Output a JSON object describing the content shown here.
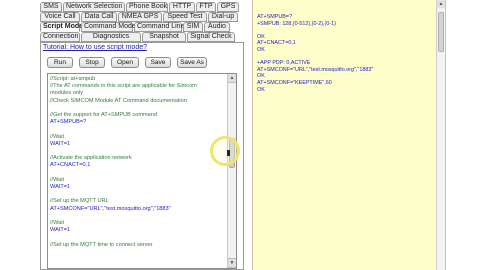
{
  "tabs": {
    "row1": [
      "SMS",
      "Network Selection",
      "Phone Book",
      "HTTP",
      "FTP",
      "GPS"
    ],
    "row2": [
      "Voice Call",
      "Data Call",
      "NMEA GPS",
      "Speed Test",
      "Dial-up"
    ],
    "row3": [
      "Script Mode",
      "Command Mode",
      "Command Line",
      "SIM",
      "Audio"
    ],
    "row4": [
      "Connection",
      "Diagnostics",
      "Snapshot",
      "Signal Check"
    ],
    "active": "Script Mode"
  },
  "tutorial_link": "Tutorial: How to use script mode?",
  "buttons": {
    "run": "Run",
    "stop": "Stop",
    "open": "Open",
    "save": "Save",
    "save_as": "Save As"
  },
  "script_lines": [
    {
      "text": "//Script: at+smpub",
      "type": "c"
    },
    {
      "text": "//The AT commands in this script are applicable for Simcom",
      "type": "c"
    },
    {
      "text": "modules only",
      "type": "c"
    },
    {
      "text": "//Check SIMCOM Module AT Command documentation",
      "type": "c"
    },
    {
      "text": "",
      "type": "k"
    },
    {
      "text": "//Get the support for AT+SMPUB command",
      "type": "c"
    },
    {
      "text": "AT+SMPUB=?",
      "type": "k"
    },
    {
      "text": "",
      "type": "k"
    },
    {
      "text": "//Wait",
      "type": "c"
    },
    {
      "text": "WAIT=1",
      "type": "k"
    },
    {
      "text": "",
      "type": "k"
    },
    {
      "text": "//Activate the application network",
      "type": "c"
    },
    {
      "text": "AT+CNACT=0,1",
      "type": "k"
    },
    {
      "text": "",
      "type": "k"
    },
    {
      "text": "//Wait",
      "type": "c"
    },
    {
      "text": "WAIT=1",
      "type": "k"
    },
    {
      "text": "",
      "type": "k"
    },
    {
      "text": "//Set up the MQTT URL",
      "type": "c"
    },
    {
      "text": "AT+SMCONF=\"URL\",\"test.mosquitto.org\",\"1883\"",
      "type": "k"
    },
    {
      "text": "",
      "type": "k"
    },
    {
      "text": "//Wait",
      "type": "c"
    },
    {
      "text": "WAIT=1",
      "type": "k"
    },
    {
      "text": "",
      "type": "k"
    },
    {
      "text": "//Set up the MQTT time to connect server",
      "type": "c"
    }
  ],
  "terminal_lines": [
    "AT+SMPUB=?",
    "+SMPUB: 128,(0-512),(0-2),(0-1)",
    "",
    "OK",
    "AT+CNACT=0,1",
    "OK",
    "",
    "+APP PDP: 0,ACTIVE",
    "AT+SMCONF=\"URL\",\"test.mosquitto.org\",\"1883\"",
    "OK",
    "AT+SMCONF=\"KEEPTIME\",60",
    "OK"
  ]
}
